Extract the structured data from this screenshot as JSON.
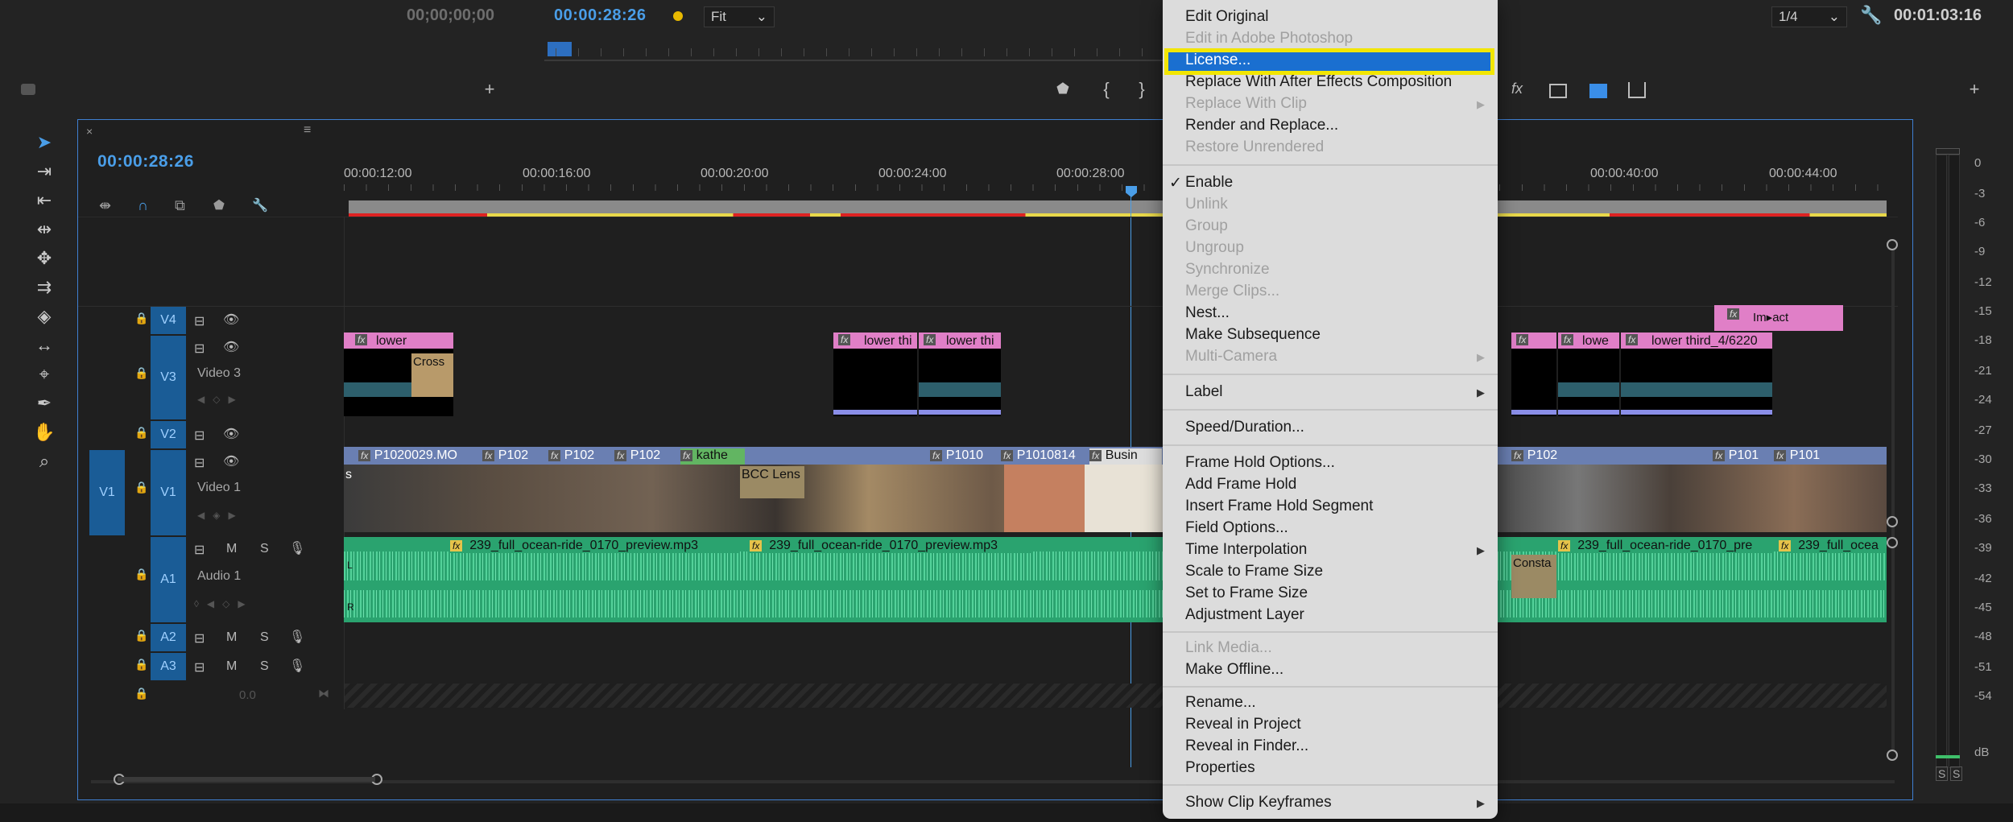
{
  "source_monitor": {
    "timecode": "00;00;00;00"
  },
  "program_monitor": {
    "timecode": "00:00:28:26",
    "fit": "Fit",
    "resolution": "1/4",
    "duration": "00:01:03:16"
  },
  "timeline": {
    "timecode": "00:00:28:26",
    "ruler": [
      "00:00:12:00",
      "00:00:16:00",
      "00:00:20:00",
      "00:00:24:00",
      "00:00:28:00",
      "00:00:40:00",
      "00:00:44:00"
    ],
    "tracks": {
      "v4": "V4",
      "v3": "V3",
      "v3_name": "Video 3",
      "v2": "V2",
      "v1_src": "V1",
      "v1": "V1",
      "v1_name": "Video 1",
      "a1": "A1",
      "a1_name": "Audio 1",
      "a2": "A2",
      "a3": "A3",
      "master_val": "0.0",
      "m": "M",
      "s": "S"
    },
    "clips": {
      "v3_a": "lower",
      "v3_a2": "Cross",
      "v3_b": "lower thi",
      "v3_c": "lower thi",
      "v3_d": "lowe",
      "v3_e": "lower third_4/6220",
      "v4_a": "Im▸act",
      "v1_a": "P1020029.MO",
      "v1_b": "P102",
      "v1_c": "P102",
      "v1_d": "P102",
      "v1_e": "kathe",
      "v1_f": "P1010",
      "v1_g": "P1010814",
      "v1_h": "Busin",
      "v1_i": "P102",
      "v1_j": "P101",
      "v1_k": "P101",
      "v1_lens": "BCC Lens",
      "v1_s": "s",
      "a1_a": "239_full_ocean-ride_0170_preview.mp3",
      "a1_b": "239_full_ocean-ride_0170_preview.mp3",
      "a1_c": "239_full_ocean-ride_0170_pre",
      "a1_d": "239_full_ocea",
      "a1_const": "Consta",
      "fx": "fx",
      "l": "L",
      "r": "R"
    }
  },
  "meter": {
    "db": [
      "0",
      "-3",
      "-6",
      "-9",
      "-12",
      "-15",
      "-18",
      "-21",
      "-24",
      "-27",
      "-30",
      "-33",
      "-36",
      "-39",
      "-42",
      "-45",
      "-48",
      "-51",
      "-54",
      "dB"
    ],
    "solo": [
      "S",
      "S"
    ]
  },
  "context_menu": {
    "items": [
      "Edit Original",
      "Edit in Adobe Photoshop",
      "License...",
      "Replace With After Effects Composition",
      "Replace With Clip",
      "Render and Replace...",
      "Restore Unrendered",
      "Enable",
      "Unlink",
      "Group",
      "Ungroup",
      "Synchronize",
      "Merge Clips...",
      "Nest...",
      "Make Subsequence",
      "Multi-Camera",
      "Label",
      "Speed/Duration...",
      "Frame Hold Options...",
      "Add Frame Hold",
      "Insert Frame Hold Segment",
      "Field Options...",
      "Time Interpolation",
      "Scale to Frame Size",
      "Set to Frame Size",
      "Adjustment Layer",
      "Link Media...",
      "Make Offline...",
      "Rename...",
      "Reveal in Project",
      "Reveal in Finder...",
      "Properties",
      "Show Clip Keyframes"
    ],
    "check": "✓",
    "highlight_color": "#1a6fd0",
    "focus_ring_color": "#f2e600"
  }
}
